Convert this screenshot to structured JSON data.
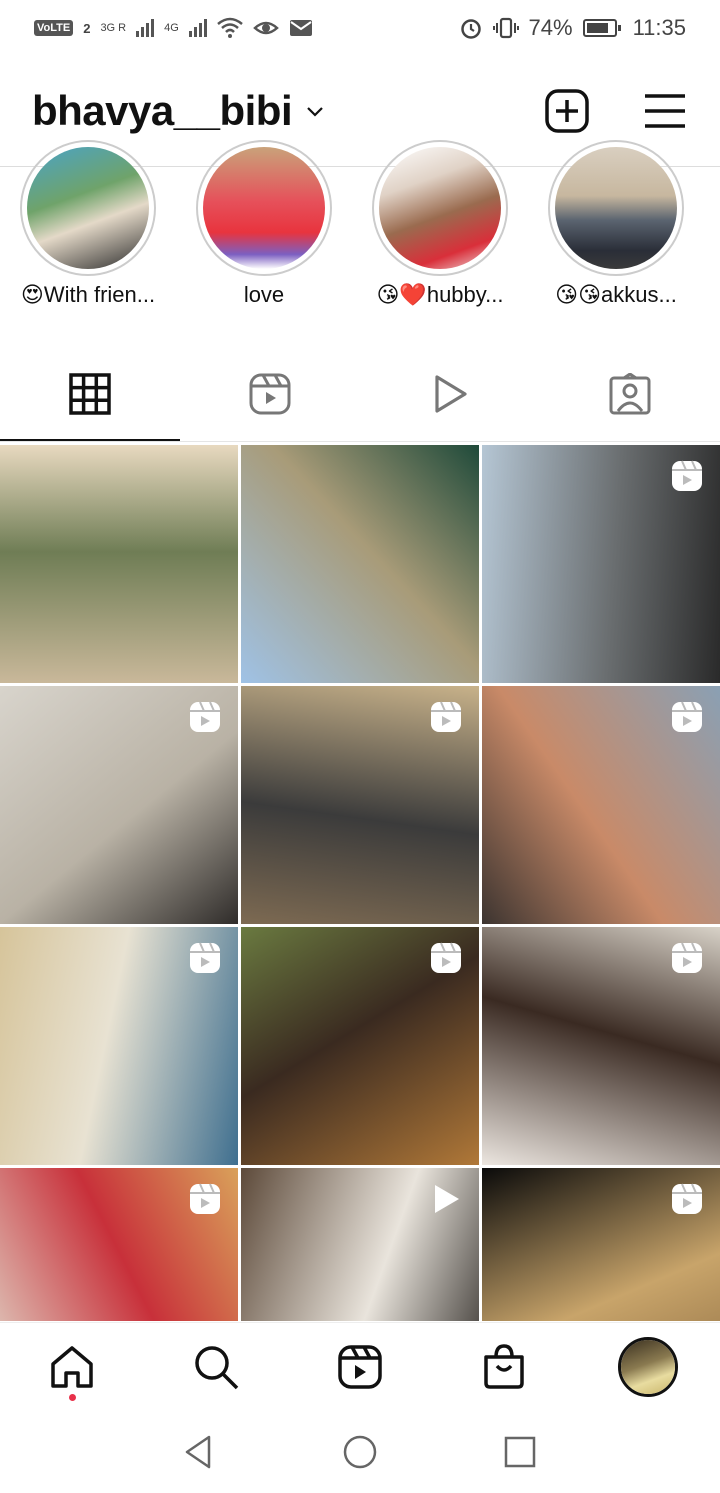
{
  "status_bar": {
    "volte": "VoLTE",
    "sim": "2",
    "net1": "3G R",
    "net2": "4G",
    "battery": "74%",
    "time": "11:35"
  },
  "header": {
    "username": "bhavya__bibi"
  },
  "highlights": [
    {
      "label": "😍With frien..."
    },
    {
      "label": "love"
    },
    {
      "label": "😘❤️hubby..."
    },
    {
      "label": "😘😘akkus..."
    }
  ],
  "tabs": [
    {
      "name": "grid",
      "active": true
    },
    {
      "name": "reels",
      "active": false
    },
    {
      "name": "videos",
      "active": false
    },
    {
      "name": "tagged",
      "active": false
    }
  ],
  "grid": [
    {
      "type": "photo",
      "colors": [
        "#c9b89a",
        "#6f7d55",
        "#e8d9c0"
      ]
    },
    {
      "type": "photo",
      "colors": [
        "#9fc2e6",
        "#a89b78",
        "#1f4a3a"
      ]
    },
    {
      "type": "reel",
      "colors": [
        "#b5c6d4",
        "#6a6e70",
        "#2a2a2a"
      ]
    },
    {
      "type": "reel",
      "colors": [
        "#d8d4cc",
        "#b9b2a5",
        "#2f2c2a"
      ]
    },
    {
      "type": "reel",
      "colors": [
        "#c8b28a",
        "#3b3b3b",
        "#7d6a52"
      ]
    },
    {
      "type": "reel",
      "colors": [
        "#8aa0b4",
        "#c98a68",
        "#3c3430"
      ]
    },
    {
      "type": "reel",
      "colors": [
        "#3f6f8f",
        "#e8e2d2",
        "#d6c49a"
      ]
    },
    {
      "type": "reel",
      "colors": [
        "#b07838",
        "#3a2a20",
        "#6a7a40"
      ]
    },
    {
      "type": "reel",
      "colors": [
        "#ece6e0",
        "#3a2a22",
        "#d8d2c8"
      ]
    },
    {
      "type": "reel",
      "colors": [
        "#e2dccd",
        "#c8303a",
        "#d9a15a"
      ]
    },
    {
      "type": "video",
      "colors": [
        "#5d4a3a",
        "#e9e4dc",
        "#2e2a26"
      ]
    },
    {
      "type": "reel",
      "colors": [
        "#0a0a0a",
        "#c8a46a",
        "#8a6a40"
      ]
    }
  ],
  "bottom_nav": [
    {
      "name": "home"
    },
    {
      "name": "search"
    },
    {
      "name": "reels"
    },
    {
      "name": "shop"
    },
    {
      "name": "profile"
    }
  ]
}
